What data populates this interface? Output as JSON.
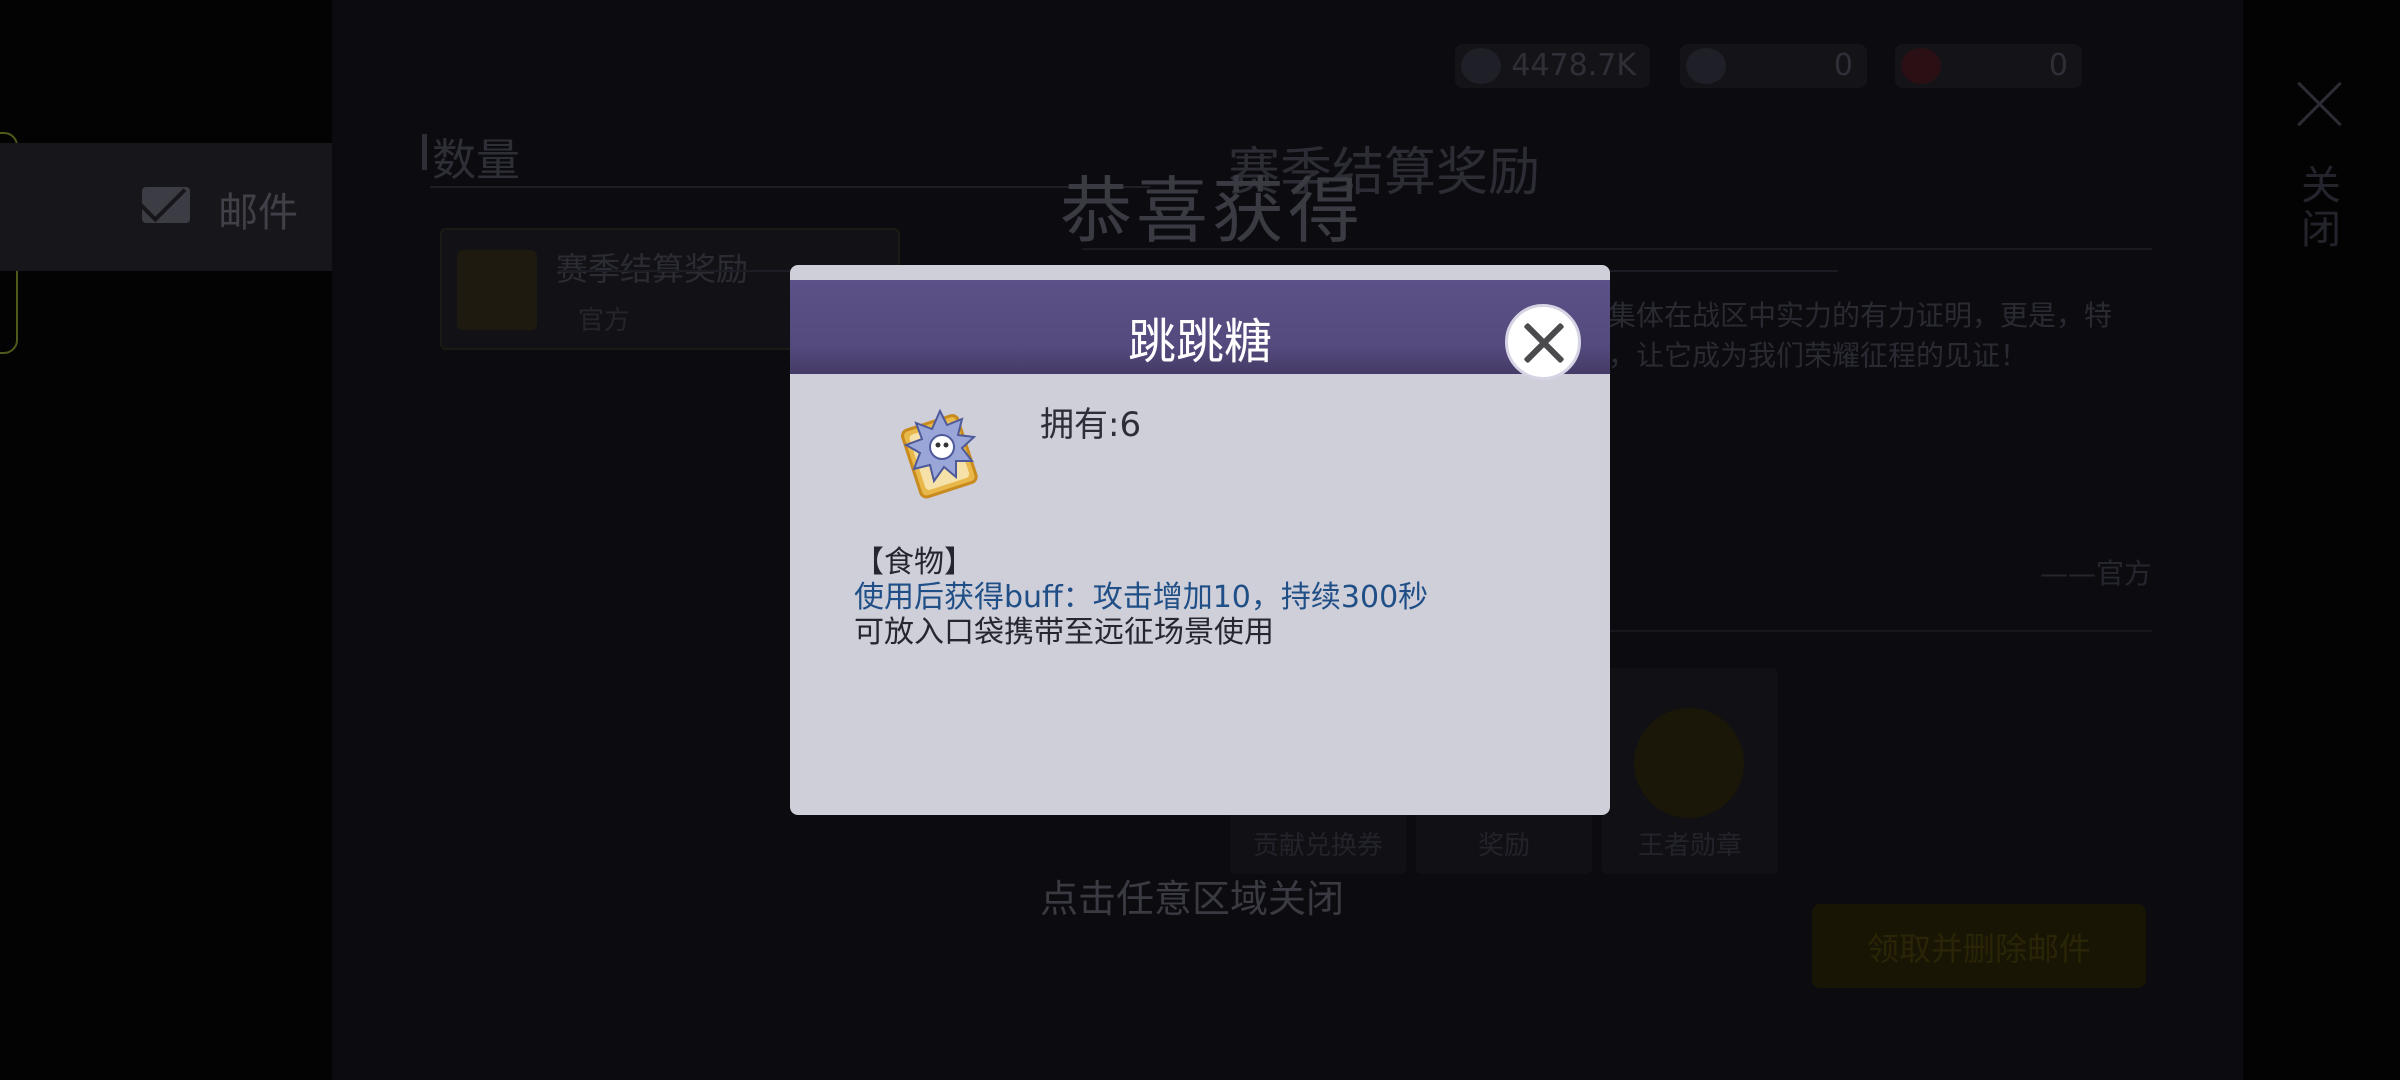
{
  "background": {
    "sidebar": {
      "mail_label": "邮件"
    },
    "list": {
      "header": "数量",
      "item_title": "赛季结算奖励",
      "item_sub": "官方"
    },
    "resources": [
      {
        "name": "coin-icon",
        "value": "4478.7K"
      },
      {
        "name": "gem-icon",
        "value": "0"
      },
      {
        "name": "ticket-icon",
        "value": "0"
      }
    ],
    "close_vertical": "关闭",
    "detail": {
      "title": "赛季结算奖励",
      "subtitle": "",
      "body": "成功达到王者！这份成就凝聚着每一位，为集体在战区中实力的有力证明，更是，特别为全体成员准备了王者勋章，请各，嘉奖，让它成为我们荣耀征程的见证！",
      "signature": "——官方",
      "rewards": [
        "贡献兑换券",
        "奖励",
        "王者勋章"
      ],
      "claim_button": "领取并删除邮件"
    }
  },
  "overlay": {
    "congrats": "恭喜获得",
    "tap_to_close": "点击任意区域关闭"
  },
  "dialog": {
    "title": "跳跳糖",
    "owned": "拥有:6",
    "item_icon": "candy-pack-icon",
    "desc_line1": "【食物】",
    "desc_line2": "使用后获得buff：攻击增加10，持续300秒",
    "desc_line3": "可放入口袋携带至远征场景使用"
  },
  "colors": {
    "title_bar": "#5c5188",
    "dialog_bg": "#cfcfd9",
    "buff_text": "#1f4f86"
  }
}
